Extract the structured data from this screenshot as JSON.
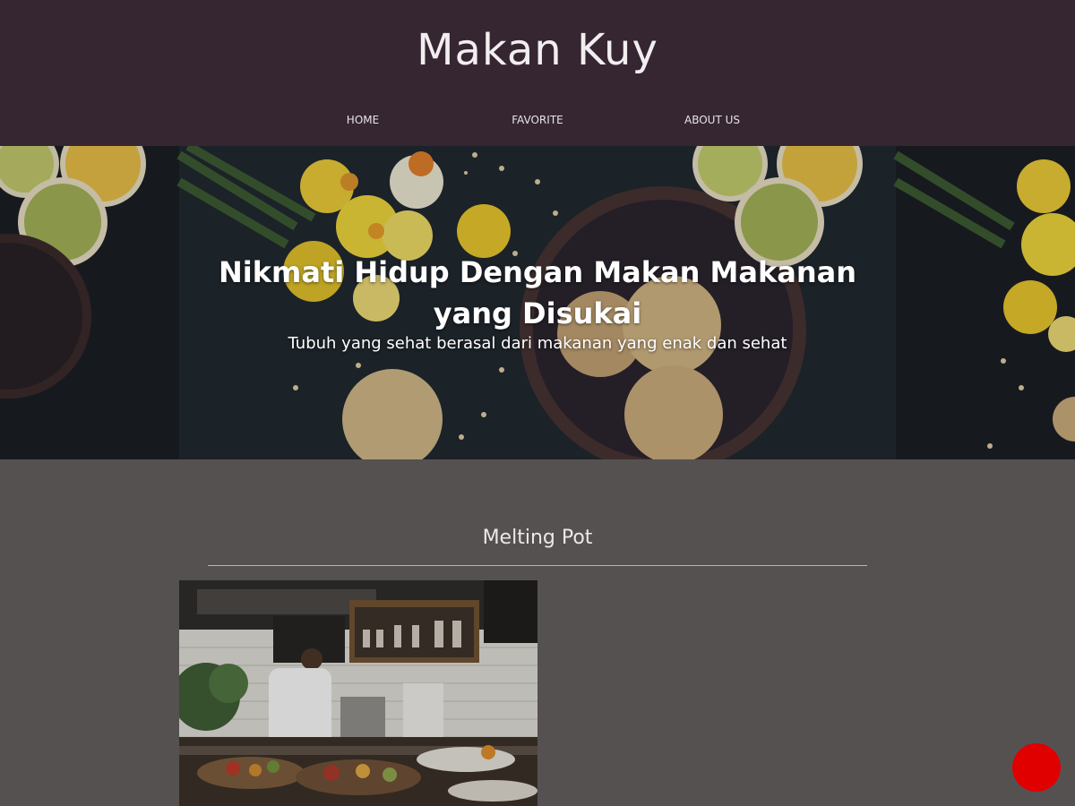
{
  "site": {
    "title": "Makan Kuy"
  },
  "nav": {
    "items": [
      {
        "label": "HOME"
      },
      {
        "label": "FAVORITE"
      },
      {
        "label": "ABOUT US"
      }
    ]
  },
  "hero": {
    "headline": "Nikmati Hidup Dengan Makan Makanan yang Disukai",
    "subheadline": "Tubuh yang sehat berasal dari makanan yang enak dan sehat",
    "image": "food-flatlay-cookies-lemons-daffodils"
  },
  "section": {
    "title": "Melting Pot",
    "card_image": "restaurant-kitchen-chef-photo"
  },
  "fab": {
    "icon": "red-circle-button"
  },
  "colors": {
    "header_bg": "#352631",
    "page_bg": "#565151",
    "fab": "#e00000",
    "text_light": "#f2eef0"
  }
}
